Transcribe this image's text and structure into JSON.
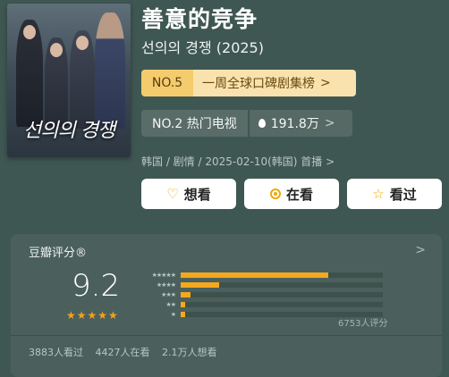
{
  "poster": {
    "title_ko": "선의의 경쟁"
  },
  "show": {
    "title": "善意的竞争",
    "subtitle": "선의의 경쟁 (2025)",
    "meta": "韩国 / 剧情 / 2025-02-10(韩国) 首播 >"
  },
  "ranking": {
    "rank": "NO.5",
    "label": "一周全球口碑剧集榜",
    "arrow": ">"
  },
  "hot": {
    "rank_text": "NO.2 热门电视",
    "heat": "191.8万",
    "arrow": ">"
  },
  "actions": {
    "want": {
      "label": "想看",
      "icon": "heart-plus-icon"
    },
    "watching": {
      "label": "在看",
      "icon": "target-icon"
    },
    "watched": {
      "label": "看过",
      "icon": "star-outline-icon"
    }
  },
  "rating": {
    "title": "豆瓣评分®",
    "score": "9.2",
    "stars": "★★★★★",
    "star_value": 4.5,
    "distribution": [
      {
        "stars": "★★★★★",
        "fraction": 0.73
      },
      {
        "stars": "★★★★",
        "fraction": 0.19
      },
      {
        "stars": "★★★",
        "fraction": 0.05
      },
      {
        "stars": "★★",
        "fraction": 0.02
      },
      {
        "stars": "★",
        "fraction": 0.02
      }
    ],
    "count_text": "6753人评分",
    "arrow": ">"
  },
  "watch_stats": {
    "watched": "3883人看过",
    "watching": "4427人在看",
    "want": "2.1万人想看"
  },
  "colors": {
    "accent": "#f5a81d",
    "background": "#3f5752",
    "rank_bg": "#f9e2ad"
  }
}
